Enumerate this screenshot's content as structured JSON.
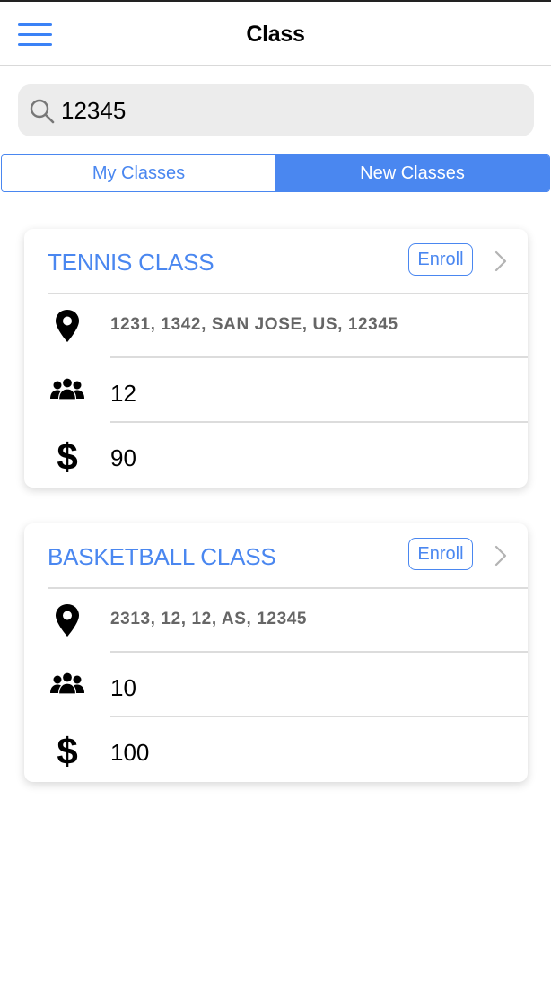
{
  "nav": {
    "title": "Class"
  },
  "search": {
    "value": "12345"
  },
  "segments": [
    {
      "label": "My Classes",
      "selected": false
    },
    {
      "label": "New Classes",
      "selected": true
    }
  ],
  "classes": [
    {
      "title": "TENNIS CLASS",
      "enroll_label": "Enroll",
      "address": "1231, 1342, SAN JOSE, US, 12345",
      "members": "12",
      "price": "90"
    },
    {
      "title": "BASKETBALL CLASS",
      "enroll_label": "Enroll",
      "address": "2313, 12, 12, AS, 12345",
      "members": "10",
      "price": "100"
    }
  ],
  "colors": {
    "accent": "#4a87f0",
    "search_bg": "#ececec",
    "divider": "#dcdcdc"
  },
  "icons": {
    "menu": "hamburger-icon",
    "search": "magnifier-icon",
    "location": "map-pin-icon",
    "members": "group-icon",
    "price": "dollar-icon",
    "chevron": "chevron-right-icon"
  }
}
